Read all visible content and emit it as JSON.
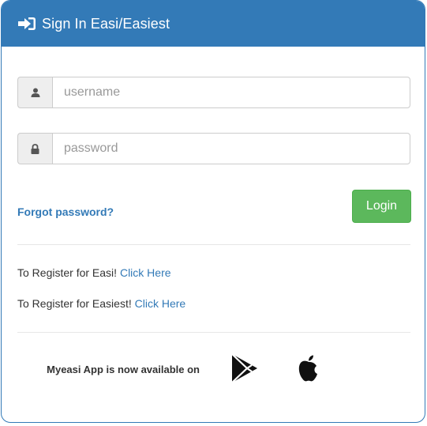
{
  "header": {
    "title": "Sign In Easi/Easiest",
    "icon": "sign-in-icon",
    "color": "#337ab7"
  },
  "form": {
    "username": {
      "placeholder": "username",
      "value": "",
      "icon": "user-icon"
    },
    "password": {
      "placeholder": "password",
      "value": "",
      "icon": "lock-icon"
    },
    "forgot_label": "Forgot password?",
    "login_label": "Login",
    "login_color": "#5cb85c"
  },
  "register": {
    "easi_text": "To Register for Easi!",
    "easi_link": "Click Here",
    "easiest_text": "To Register for Easiest!",
    "easiest_link": "Click Here"
  },
  "app": {
    "text": "Myeasi App is now available on",
    "icons": [
      "google-play-icon",
      "apple-icon"
    ]
  }
}
